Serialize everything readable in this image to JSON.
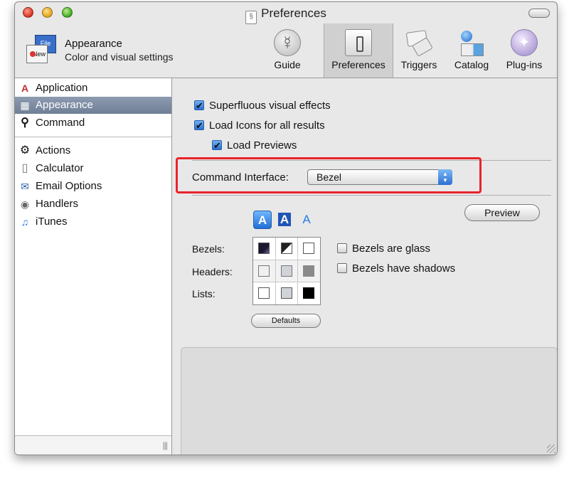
{
  "window": {
    "title": "Preferences"
  },
  "pane": {
    "title": "Appearance",
    "subtitle": "Color and visual settings",
    "icon_back_label": "File",
    "icon_front_label": "New"
  },
  "toolbar": {
    "items": [
      {
        "label": "Guide",
        "icon": "guide-icon"
      },
      {
        "label": "Preferences",
        "icon": "preferences-icon",
        "selected": true
      },
      {
        "label": "Triggers",
        "icon": "triggers-icon"
      },
      {
        "label": "Catalog",
        "icon": "catalog-icon"
      },
      {
        "label": "Plug-ins",
        "icon": "plugins-icon"
      }
    ]
  },
  "sidebar": {
    "items": [
      {
        "label": "Application",
        "icon": "application-icon",
        "glyph": "A"
      },
      {
        "label": "Appearance",
        "icon": "appearance-icon",
        "glyph": "▦",
        "selected": true
      },
      {
        "label": "Command",
        "icon": "search-icon",
        "glyph": "⚲"
      },
      {
        "label": "Actions",
        "icon": "gear-icon",
        "glyph": "⚙"
      },
      {
        "label": "Calculator",
        "icon": "calculator-icon",
        "glyph": "▯"
      },
      {
        "label": "Email Options",
        "icon": "mail-icon",
        "glyph": "✉"
      },
      {
        "label": "Handlers",
        "icon": "handlers-icon",
        "glyph": "◉"
      },
      {
        "label": "iTunes",
        "icon": "music-note-icon",
        "glyph": "♫"
      }
    ],
    "grip": "|||"
  },
  "options": {
    "superfluous_effects": {
      "label": "Superfluous visual effects",
      "checked": true
    },
    "load_icons": {
      "label": "Load Icons for all results",
      "checked": true
    },
    "load_previews": {
      "label": "Load Previews",
      "checked": true
    }
  },
  "command_interface": {
    "label": "Command Interface:",
    "value": "Bezel",
    "highlight_color": "#e8242c"
  },
  "preview_button": "Preview",
  "appearance_tabs": [
    "A",
    "A",
    "A"
  ],
  "grid": {
    "row_labels": [
      "Bezels:",
      "Headers:",
      "Lists:"
    ]
  },
  "glass": {
    "label": "Bezels are glass",
    "checked": false
  },
  "shadows": {
    "label": "Bezels have shadows",
    "checked": false
  },
  "defaults_button": "Defaults",
  "colors": {
    "selection": "#7b8aa1",
    "accent_blue": "#2a6fd0"
  }
}
